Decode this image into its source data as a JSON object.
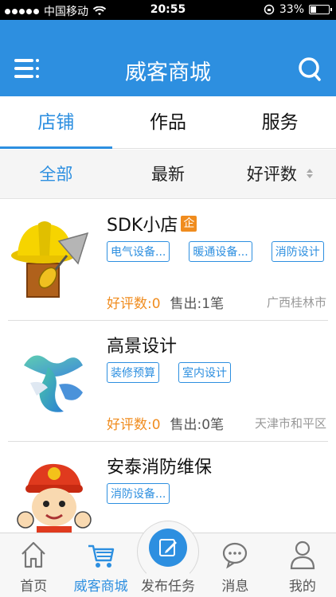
{
  "status_bar": {
    "carrier": "中国移动",
    "time": "20:55",
    "battery": "33%",
    "battery_level": 0.33
  },
  "header": {
    "title": "威客商城",
    "menu_icon": "menu-icon",
    "search_icon": "search-icon"
  },
  "tabs": [
    {
      "label": "店铺",
      "active": true
    },
    {
      "label": "作品",
      "active": false
    },
    {
      "label": "服务",
      "active": false
    }
  ],
  "sort": [
    {
      "label": "全部",
      "active": true
    },
    {
      "label": "最新",
      "active": false
    },
    {
      "label": "好评数",
      "active": false
    }
  ],
  "shops": [
    {
      "name": "SDK小店",
      "badge": "企",
      "tags": [
        "电气设备...",
        "暖通设备...",
        "消防设计"
      ],
      "rating": "好评数:0",
      "sold": "售出:1笔",
      "city": "广西桂林市",
      "image": "hard-hat-trowel-image"
    },
    {
      "name": "高景设计",
      "tags": [
        "装修预算",
        "室内设计"
      ],
      "rating": "好评数:0",
      "sold": "售出:0笔",
      "city": "天津市和平区",
      "image": "abstract-logo-image"
    },
    {
      "name": "安泰消防维保",
      "tags": [
        "消防设备..."
      ],
      "rating": "",
      "sold": "",
      "city": "",
      "image": "firefighter-cartoon-image"
    }
  ],
  "bottom_nav": [
    {
      "label": "首页",
      "icon": "home-icon",
      "active": false
    },
    {
      "label": "威客商城",
      "icon": "cart-icon",
      "active": true
    },
    {
      "label": "发布任务",
      "icon": "edit-icon",
      "active": false
    },
    {
      "label": "消息",
      "icon": "chat-icon",
      "active": false
    },
    {
      "label": "我的",
      "icon": "user-icon",
      "active": false
    }
  ],
  "colors": {
    "accent": "#2d8fe0",
    "orange": "#f08c1e"
  }
}
